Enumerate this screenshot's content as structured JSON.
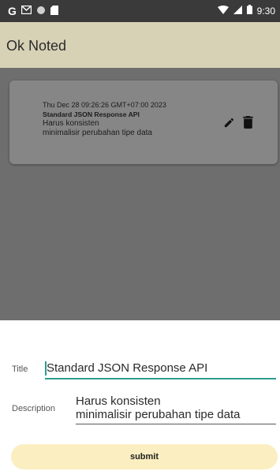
{
  "status_bar": {
    "time": "9:30",
    "left_icons": [
      "google-icon",
      "gmail-icon",
      "circle-icon",
      "sd-card-icon"
    ],
    "right_icons": [
      "wifi-icon",
      "signal-icon",
      "battery-icon"
    ]
  },
  "app_bar": {
    "title": "Ok Noted",
    "color": "#d7d1b6"
  },
  "notes": [
    {
      "date": "Thu Dec 28 09:26:26 GMT+07:00 2023",
      "title": "Standard JSON Response API",
      "description": "Harus konsisten\nminimalisir perubahan tipe data",
      "edit_icon": "pencil-icon",
      "delete_icon": "trash-icon"
    }
  ],
  "form": {
    "title_label": "Title",
    "title_value": "Standard JSON Response API",
    "description_label": "Description",
    "description_value": "Harus konsisten\nminimalisir perubahan tipe data",
    "submit_label": "submit",
    "accent_color": "#2e9b8e",
    "button_color": "#fbeec0"
  }
}
